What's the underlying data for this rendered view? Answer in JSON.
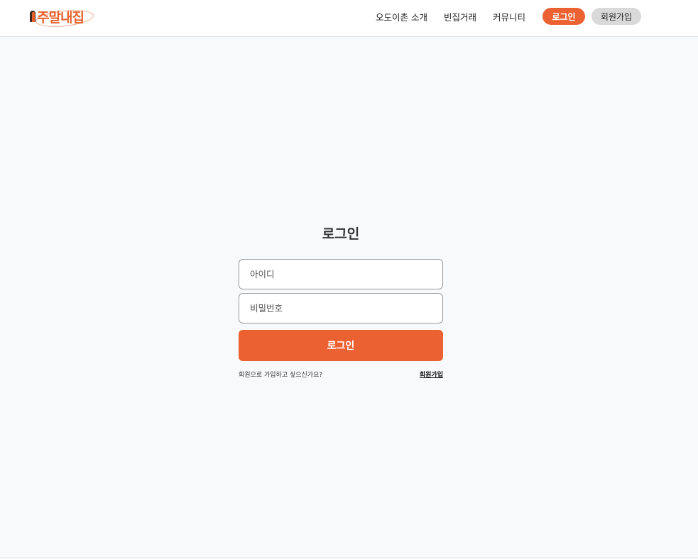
{
  "header": {
    "logo_text": "주말내집",
    "nav": {
      "about": "오도이촌 소개",
      "vacant_house": "빈집거래",
      "community": "커뮤니티"
    },
    "login_label": "로그인",
    "signup_label": "회원가입"
  },
  "login": {
    "title": "로그인",
    "id_placeholder": "아이디",
    "password_placeholder": "비밀번호",
    "submit_label": "로그인",
    "signup_prompt": "회원으로 가입하고 싶으신가요?",
    "signup_link": "회원가입"
  },
  "colors": {
    "accent": "#ec6132",
    "background": "#f8f9fb",
    "secondary_button": "#d9d9d9"
  }
}
